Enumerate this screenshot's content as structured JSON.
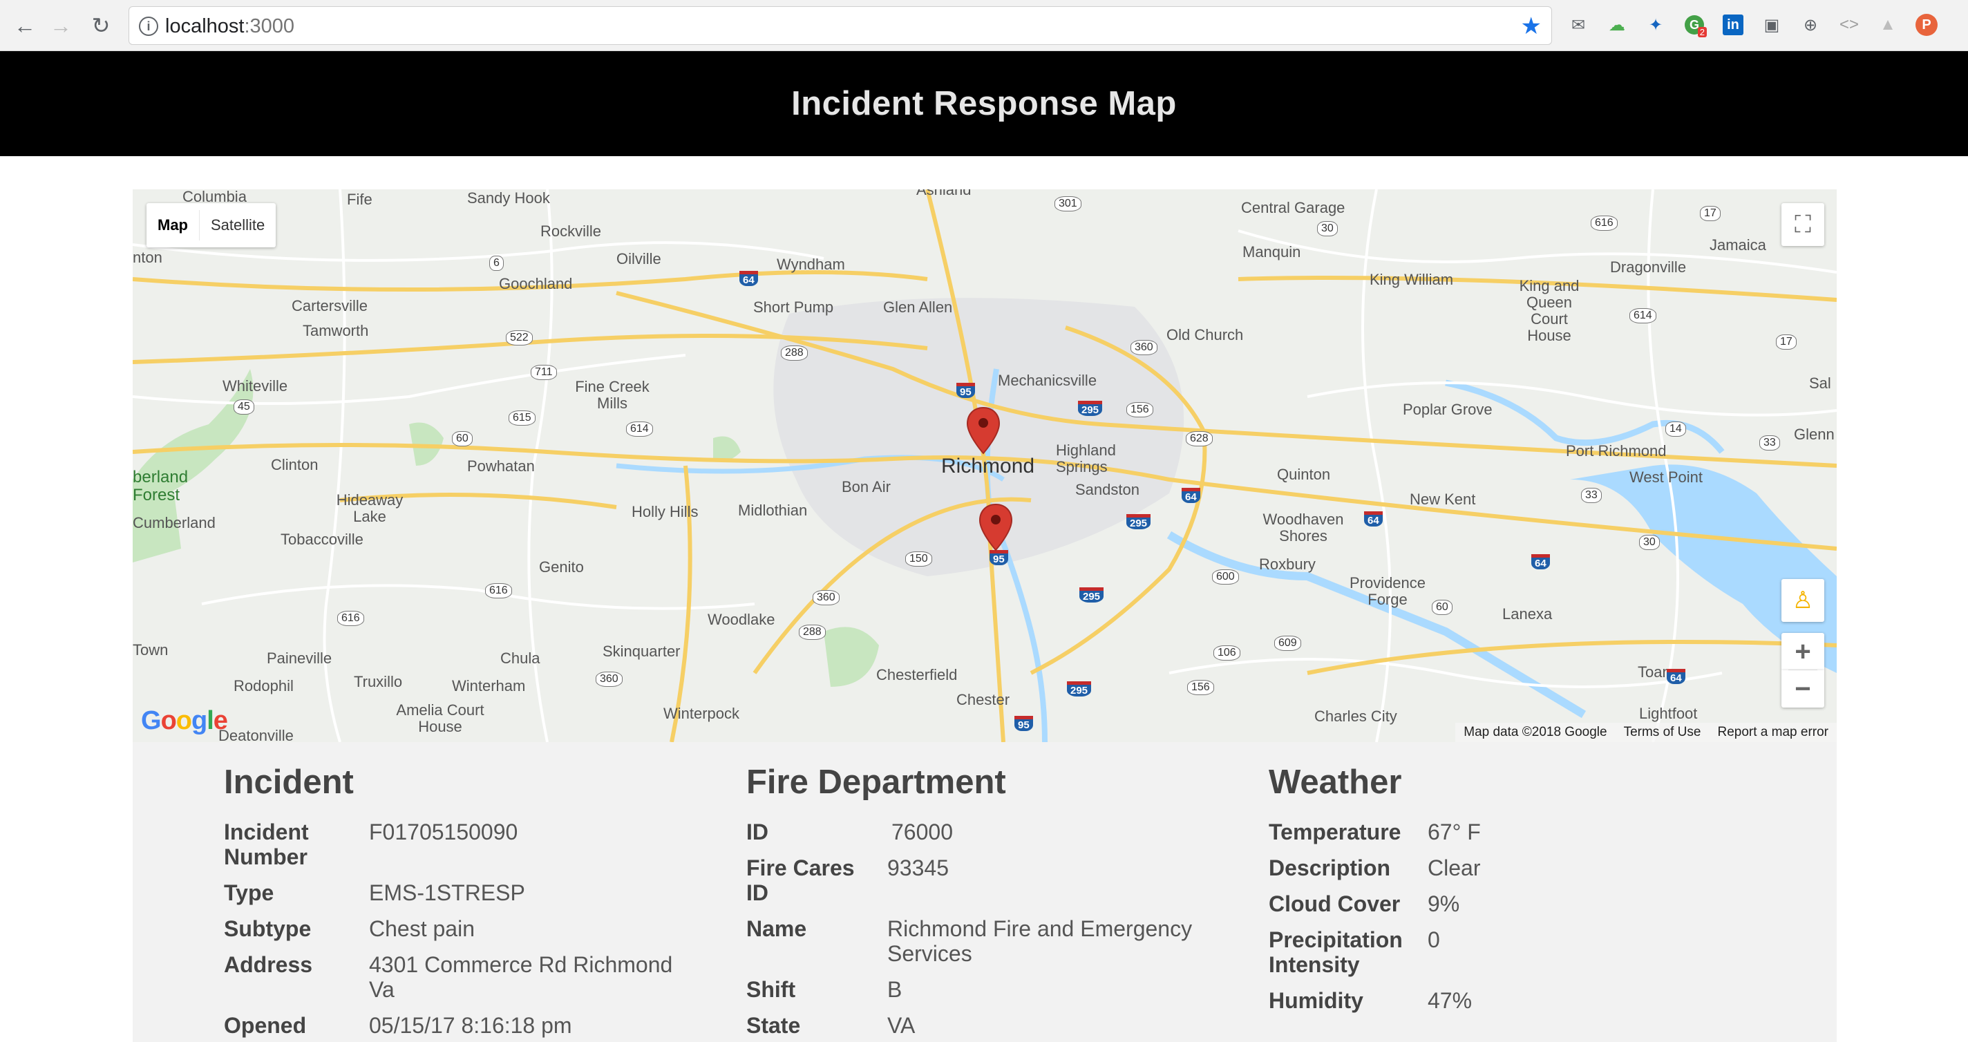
{
  "browser": {
    "url_host": "localhost",
    "url_port": ":3000",
    "icons": [
      "back-icon",
      "forward-icon",
      "reload-icon",
      "info-icon",
      "bookmark-star-icon"
    ],
    "extensions": [
      "mail-icon",
      "extension-cloud-icon",
      "extension-puzzle-icon",
      "extension-badge-icon",
      "linkedin-icon",
      "extension-window-icon",
      "extension-globe-icon",
      "devtools-icon",
      "extension-tree-icon",
      "profile-icon"
    ],
    "extension_badge_count": "2",
    "linkedin_label": "in",
    "profile_initial": "P"
  },
  "header": {
    "title": "Incident Response Map"
  },
  "map": {
    "type_control": {
      "map_label": "Map",
      "satellite_label": "Satellite"
    },
    "google_logo": "Google",
    "footer": {
      "data": "Map data ©2018 Google",
      "terms": "Terms of Use",
      "report": "Report a map error"
    },
    "city_label": "Richmond",
    "place_labels": [
      "Columbia",
      "Fife",
      "Sandy Hook",
      "Ashland",
      "Central Garage",
      "Jamaica",
      "Rockville",
      "Oilville",
      "Wyndham",
      "Manquin",
      "King William",
      "Dragonville",
      "Goochland",
      "Short Pump",
      "Glen Allen",
      "King and Queen Court House",
      "Cartersville",
      "Tamworth",
      "Old Church",
      "Mechanicsville",
      "Whiteville",
      "Fine Creek Mills",
      "Poplar Grove",
      "Clinton",
      "Powhatan",
      "Highland Springs",
      "Sandston",
      "Quinton",
      "Port Richmond",
      "West Point",
      "Glenn",
      "Bon Air",
      "Hideaway Lake",
      "Holly Hills",
      "Midlothian",
      "New Kent",
      "Woodhaven Shores",
      "Cumberland",
      "Tobaccoville",
      "Genito",
      "Roxbury",
      "Providence Forge",
      "Lanexa",
      "Woodlake",
      "Paineville",
      "Chula",
      "Skinquarter",
      "Rodophil",
      "Truxillo",
      "Winterham",
      "Chesterfield",
      "Toano",
      "Amelia Court House",
      "Winterpock",
      "Chester",
      "Charles City",
      "Lightfoot",
      "Deatonville",
      "Sal",
      "nton",
      "Town"
    ],
    "green_labels": [
      "berland Forest"
    ],
    "markers": 2
  },
  "incident": {
    "heading": "Incident",
    "rows": [
      {
        "k": "Incident Number",
        "v": "F01705150090"
      },
      {
        "k": "Type",
        "v": "EMS-1STRESP"
      },
      {
        "k": "Subtype",
        "v": "Chest pain"
      },
      {
        "k": "Address",
        "v": "4301 Commerce Rd Richmond Va"
      },
      {
        "k": "Opened",
        "v": "05/15/17 8:16:18 pm"
      }
    ]
  },
  "fire_department": {
    "heading": "Fire Department",
    "rows": [
      {
        "k": "ID",
        "v": "76000"
      },
      {
        "k": "Fire Cares ID",
        "v": "93345"
      },
      {
        "k": "Name",
        "v": "Richmond Fire and Emergency Services"
      },
      {
        "k": "Shift",
        "v": "B"
      },
      {
        "k": "State",
        "v": "VA"
      }
    ]
  },
  "weather": {
    "heading": "Weather",
    "rows": [
      {
        "k": "Temperature",
        "v": "67° F"
      },
      {
        "k": "Description",
        "v": "Clear"
      },
      {
        "k": "Cloud Cover",
        "v": "9%"
      },
      {
        "k": "Precipitation Intensity",
        "v": "0"
      },
      {
        "k": "Humidity",
        "v": "47%"
      }
    ]
  },
  "colors": {
    "header_bg": "#000000",
    "marker": "#d63b30",
    "highway": "#f6cf65",
    "water": "#aadaff",
    "park": "#c8e6c0"
  }
}
